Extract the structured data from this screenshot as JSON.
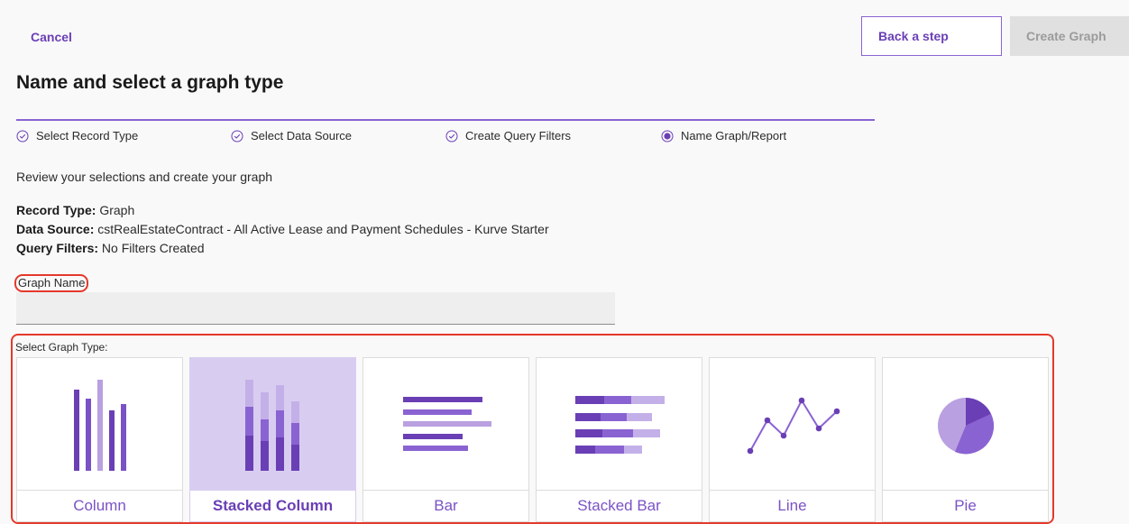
{
  "header": {
    "cancel_label": "Cancel",
    "back_label": "Back a step",
    "create_label": "Create Graph"
  },
  "page_title": "Name and select a graph type",
  "steps": [
    {
      "label": "Select Record Type",
      "state": "complete"
    },
    {
      "label": "Select Data Source",
      "state": "complete"
    },
    {
      "label": "Create Query Filters",
      "state": "complete"
    },
    {
      "label": "Name Graph/Report",
      "state": "current"
    }
  ],
  "review_text": "Review your selections and create your graph",
  "summary": {
    "record_type_label": "Record Type:",
    "record_type_value": "Graph",
    "data_source_label": "Data Source:",
    "data_source_value": "cstRealEstateContract - All Active Lease and Payment Schedules - Kurve Starter",
    "query_filters_label": "Query Filters:",
    "query_filters_value": "No Filters Created"
  },
  "graph_name": {
    "label": "Graph Name",
    "value": "",
    "placeholder": ""
  },
  "graph_type": {
    "label": "Select Graph Type:",
    "selected": "Stacked Column",
    "options": [
      {
        "label": "Column",
        "icon": "column-chart-icon"
      },
      {
        "label": "Stacked Column",
        "icon": "stacked-column-chart-icon"
      },
      {
        "label": "Bar",
        "icon": "bar-chart-icon"
      },
      {
        "label": "Stacked Bar",
        "icon": "stacked-bar-chart-icon"
      },
      {
        "label": "Line",
        "icon": "line-chart-icon"
      },
      {
        "label": "Pie",
        "icon": "pie-chart-icon"
      }
    ]
  },
  "colors": {
    "accent": "#6a3fb5",
    "accent_mid": "#8a63d2",
    "accent_light": "#b9a0e0",
    "selected_tile": "#d8cdf0",
    "highlight_red": "#e5392c"
  }
}
